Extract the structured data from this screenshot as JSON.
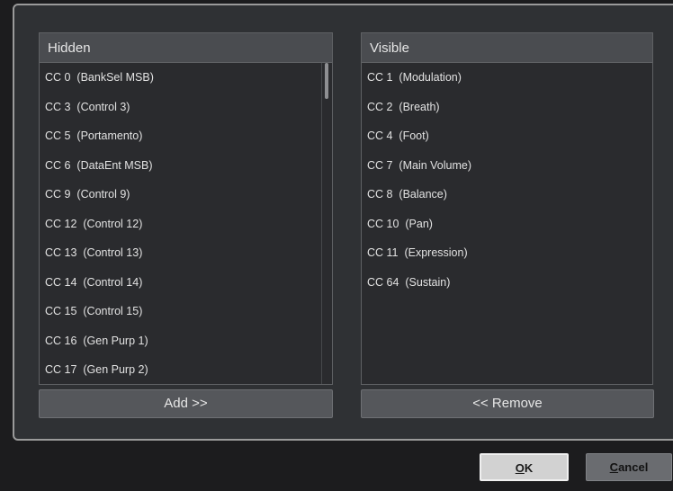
{
  "hidden_list": {
    "header": "Hidden",
    "items": [
      "CC 0  (BankSel MSB)",
      "CC 3  (Control 3)",
      "CC 5  (Portamento)",
      "CC 6  (DataEnt MSB)",
      "CC 9  (Control 9)",
      "CC 12  (Control 12)",
      "CC 13  (Control 13)",
      "CC 14  (Control 14)",
      "CC 15  (Control 15)",
      "CC 16  (Gen Purp 1)",
      "CC 17  (Gen Purp 2)"
    ]
  },
  "visible_list": {
    "header": "Visible",
    "items": [
      "CC 1  (Modulation)",
      "CC 2  (Breath)",
      "CC 4  (Foot)",
      "CC 7  (Main Volume)",
      "CC 8  (Balance)",
      "CC 10  (Pan)",
      "CC 11  (Expression)",
      "CC 64  (Sustain)"
    ]
  },
  "buttons": {
    "add": "Add >>",
    "remove": "<< Remove",
    "ok_mnemonic": "O",
    "ok_rest": "K",
    "cancel_mnemonic": "C",
    "cancel_rest": "ancel"
  },
  "colors": {
    "background": "#1c1c1e",
    "panel": "#2f3134",
    "header": "#4a4c50",
    "button": "#55575b",
    "ok_button": "#d2d2d2"
  }
}
